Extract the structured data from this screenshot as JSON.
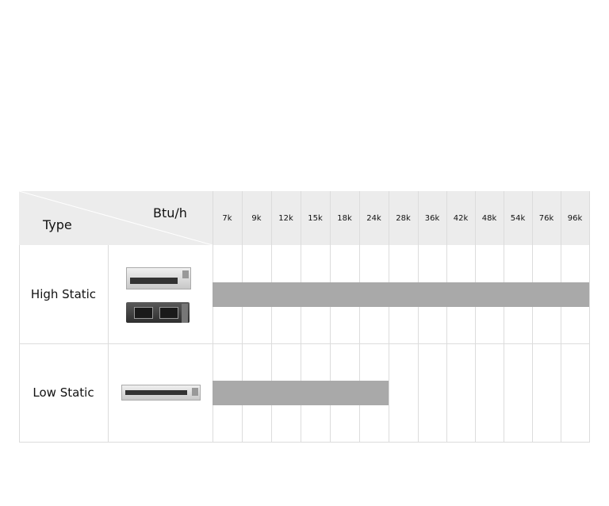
{
  "chart_data": {
    "type": "bar",
    "subtype": "range-table",
    "header": {
      "row_label": "Type",
      "column_label": "Btu/h"
    },
    "categories": [
      "7k",
      "9k",
      "12k",
      "15k",
      "18k",
      "24k",
      "28k",
      "36k",
      "42k",
      "48k",
      "54k",
      "76k",
      "96k"
    ],
    "series": [
      {
        "name": "High Static",
        "range": [
          "7k",
          "96k"
        ],
        "images": [
          "ceiling-duct-unit-silver",
          "ceiling-duct-unit-black"
        ]
      },
      {
        "name": "Low Static",
        "range": [
          "7k",
          "24k"
        ],
        "images": [
          "slim-duct-unit"
        ]
      }
    ],
    "bar_color": "#a9a9a9",
    "header_color": "#ececec",
    "grid": true
  }
}
